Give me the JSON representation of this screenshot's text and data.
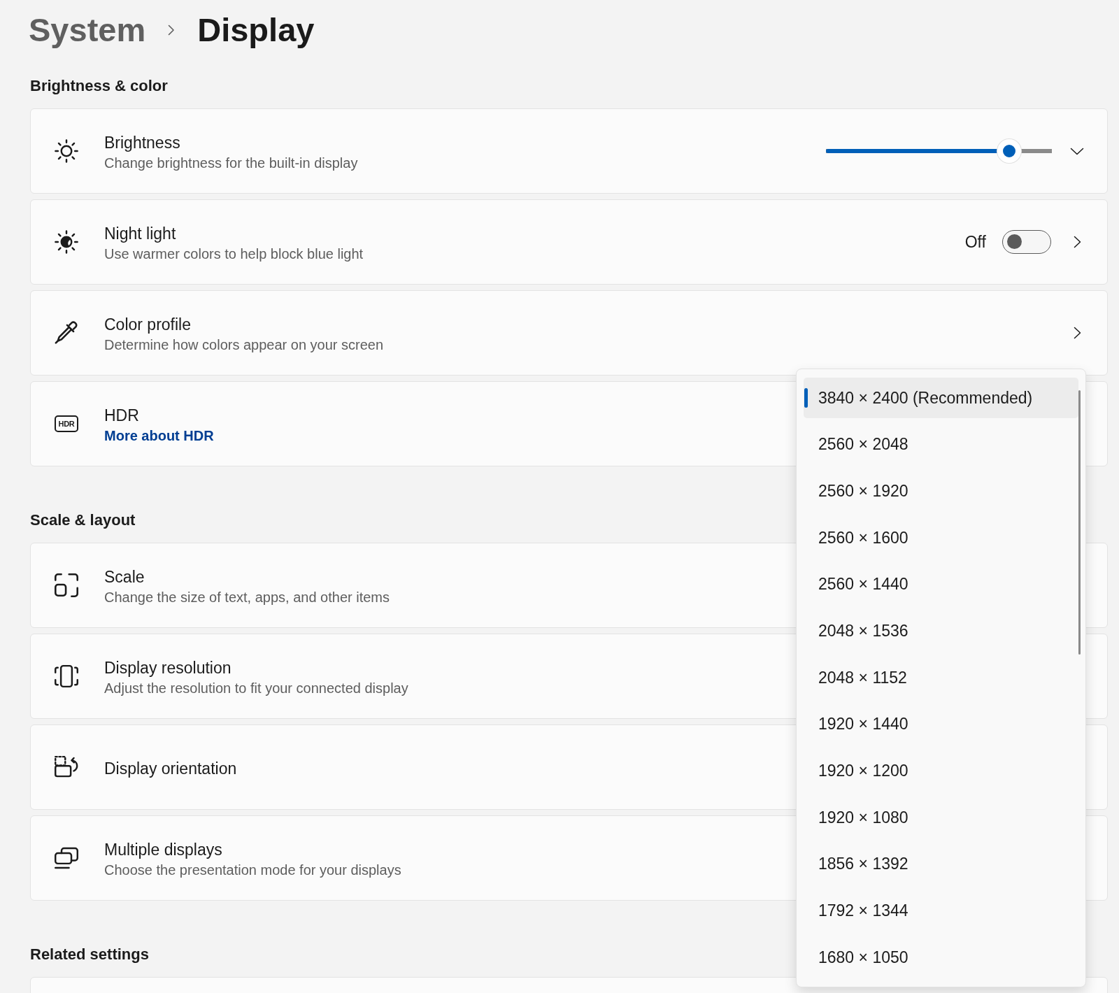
{
  "breadcrumb": {
    "parent": "System",
    "current": "Display"
  },
  "sections": [
    {
      "heading": "Brightness & color",
      "items": [
        {
          "kind": "slider",
          "title": "Brightness",
          "description": "Change brightness for the built-in display",
          "level": 0.81
        },
        {
          "kind": "toggle",
          "title": "Night light",
          "description": "Use warmer colors to help block blue light",
          "state_label": "Off",
          "on": false
        },
        {
          "kind": "chevron",
          "title": "Color profile",
          "description": "Determine how colors appear on your screen"
        },
        {
          "kind": "plain",
          "title": "HDR",
          "icon_label": "HDR",
          "link": "More about HDR"
        }
      ]
    },
    {
      "heading": "Scale & layout",
      "items": [
        {
          "kind": "plain",
          "title": "Scale",
          "description": "Change the size of text, apps, and other items"
        },
        {
          "kind": "plain",
          "title": "Display resolution",
          "description": "Adjust the resolution to fit your connected display"
        },
        {
          "kind": "plain",
          "title": "Display orientation"
        },
        {
          "kind": "plain",
          "title": "Multiple displays",
          "description": "Choose the presentation mode for your displays"
        }
      ]
    },
    {
      "heading": "Related settings",
      "items": [
        {
          "kind": "plain"
        }
      ]
    }
  ],
  "resolution_dropdown": {
    "options": [
      {
        "label": "3840 × 2400 (Recommended)",
        "selected": true
      },
      {
        "label": "2560 × 2048",
        "selected": false
      },
      {
        "label": "2560 × 1920",
        "selected": false
      },
      {
        "label": "2560 × 1600",
        "selected": false
      },
      {
        "label": "2560 × 1440",
        "selected": false
      },
      {
        "label": "2048 × 1536",
        "selected": false
      },
      {
        "label": "2048 × 1152",
        "selected": false
      },
      {
        "label": "1920 × 1440",
        "selected": false
      },
      {
        "label": "1920 × 1200",
        "selected": false
      },
      {
        "label": "1920 × 1080",
        "selected": false
      },
      {
        "label": "1856 × 1392",
        "selected": false
      },
      {
        "label": "1792 × 1344",
        "selected": false
      },
      {
        "label": "1680 × 1050",
        "selected": false
      }
    ]
  }
}
